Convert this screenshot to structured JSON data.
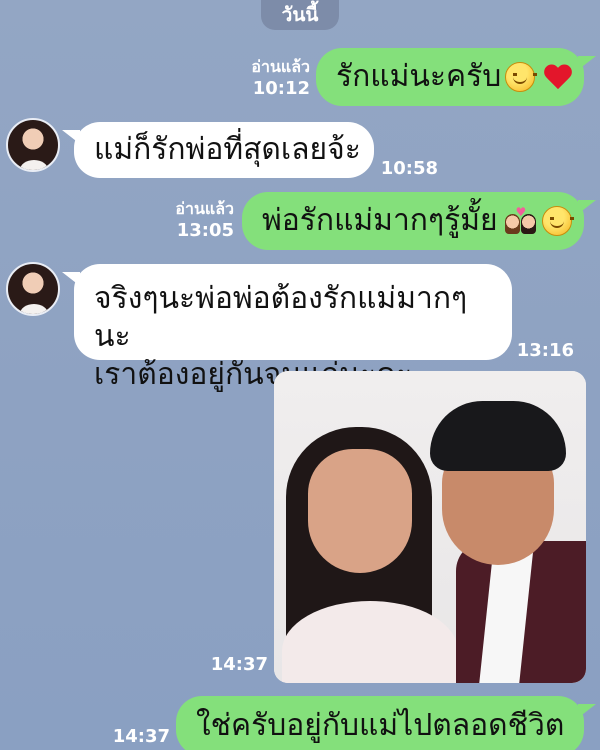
{
  "date_divider": "วันนี้",
  "messages": [
    {
      "direction": "out",
      "text": "รักแม่นะครับ",
      "read_label": "อ่านแล้ว",
      "time": "10:12",
      "emojis": [
        "smiling-face",
        "red-heart"
      ]
    },
    {
      "direction": "in",
      "text": "แม่ก็รักพ่อที่สุดเลยจ้ะ",
      "time": "10:58"
    },
    {
      "direction": "out",
      "text": "พ่อรักแม่มากๆรู้มั้ย",
      "read_label": "อ่านแล้ว",
      "time": "13:05",
      "emojis": [
        "couple-with-heart",
        "smiling-face"
      ]
    },
    {
      "direction": "in",
      "lines": [
        "จริงๆนะพ่อพ่อต้องรักแม่มากๆนะ",
        "เราต้องอยู่กันจนแก่นะคะ"
      ],
      "time": "13:16"
    },
    {
      "direction": "in",
      "type": "photo",
      "time": "14:37"
    },
    {
      "direction": "out",
      "text": "ใช่ครับอยู่กับแม่ไปตลอดชีวิต",
      "time": "14:37"
    }
  ],
  "colors": {
    "background": "#8fa3c3",
    "outgoing_bubble": "#84e07b",
    "incoming_bubble": "#ffffff",
    "date_pill": "#7d8ca9"
  }
}
